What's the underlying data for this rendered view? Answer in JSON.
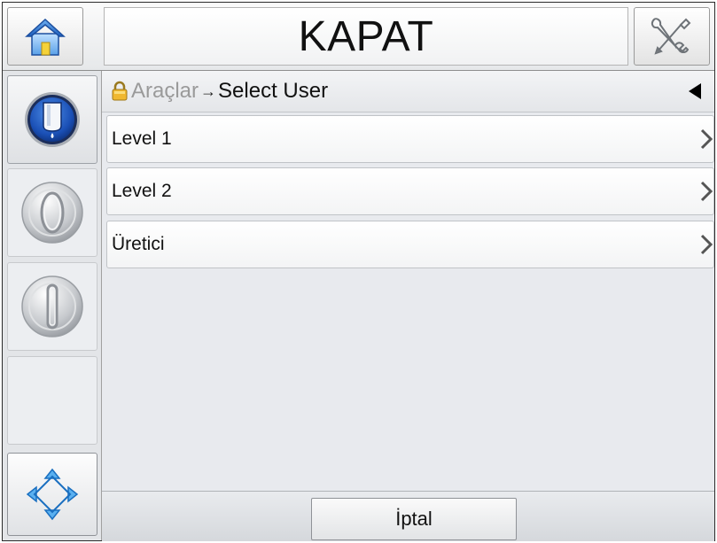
{
  "header": {
    "title": "KAPAT",
    "home_icon": "home-icon",
    "tools_icon": "tools-icon"
  },
  "sidebar": {
    "items": [
      {
        "icon": "ink-cartridge-icon",
        "state": "active"
      },
      {
        "icon": "start-jet-icon",
        "state": "inactive"
      },
      {
        "icon": "stop-jet-icon",
        "state": "inactive"
      },
      {
        "icon": "empty-slot",
        "state": "inactive"
      },
      {
        "icon": "navigation-arrows-icon",
        "state": "active"
      }
    ]
  },
  "breadcrumb": {
    "parent": "Araçlar",
    "separator": "→",
    "current": "Select User"
  },
  "menu": {
    "items": [
      {
        "label": "Level 1"
      },
      {
        "label": "Level 2"
      },
      {
        "label": "Üretici"
      }
    ]
  },
  "footer": {
    "cancel_label": "İptal"
  },
  "colors": {
    "accent_blue": "#1f5fbf",
    "lock_gold": "#e0a020",
    "background": "#e8eaee"
  }
}
